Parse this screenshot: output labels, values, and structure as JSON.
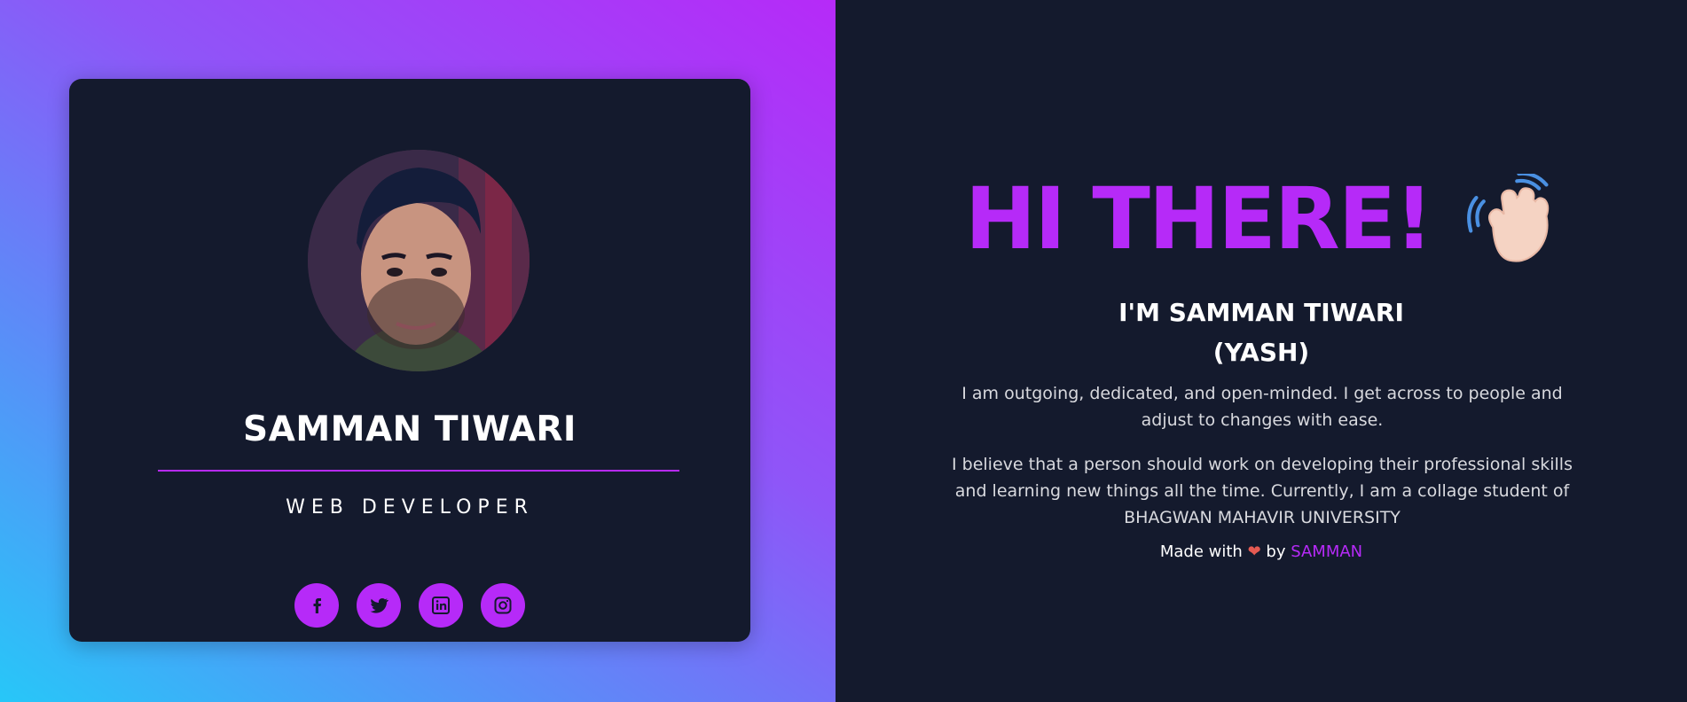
{
  "colors": {
    "accent": "#b62af8",
    "background": "#141a2d",
    "text": "#ffffff",
    "muted_text": "#d8d9de",
    "heart": "#e55a52"
  },
  "card": {
    "name": "SAMMAN TIWARI",
    "role": "WEB DEVELOPER",
    "avatar_icon": "profile-photo",
    "socials": [
      {
        "name": "facebook",
        "icon": "facebook-icon"
      },
      {
        "name": "twitter",
        "icon": "twitter-icon"
      },
      {
        "name": "linkedin",
        "icon": "linkedin-icon"
      },
      {
        "name": "instagram",
        "icon": "instagram-icon"
      }
    ]
  },
  "hero": {
    "title": "HI THERE!",
    "wave_icon": "waving-hand-icon",
    "subtitle_line1": "I'M SAMMAN TIWARI",
    "subtitle_line2": "(YASH)",
    "paragraph1": "I am outgoing, dedicated, and open-minded. I get across to people and adjust to changes with ease.",
    "paragraph2": "I believe that a person should work on developing their professional skills and learning new things all the time. Currently, I am a collage student of BHAGWAN MAHAVIR UNIVERSITY"
  },
  "footer": {
    "made_with": "Made with",
    "heart": "❤",
    "by": "by",
    "author": "SAMMAN"
  }
}
